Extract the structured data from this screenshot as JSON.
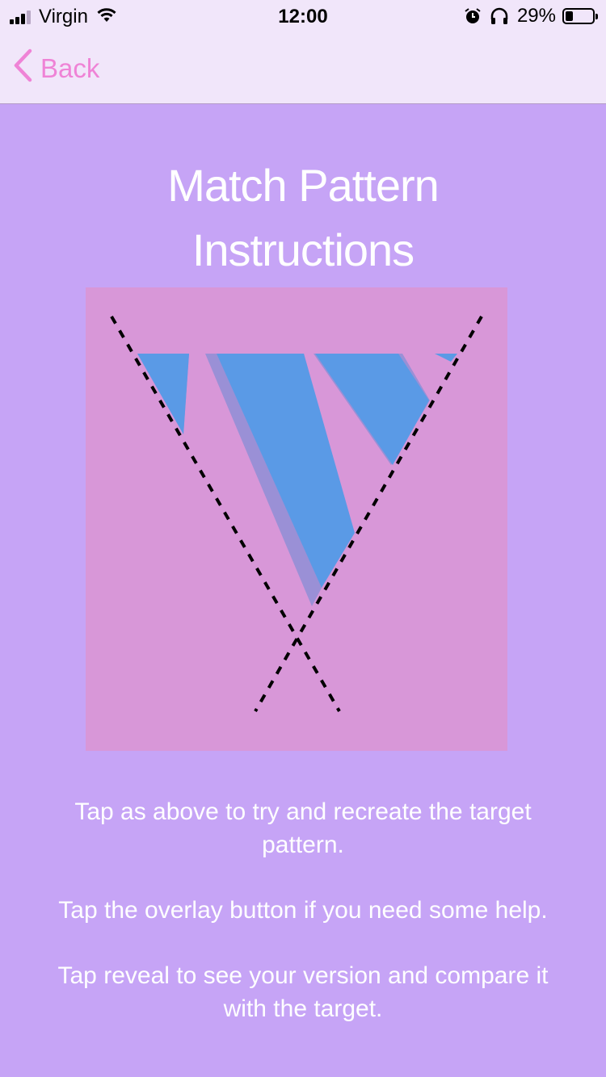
{
  "status_bar": {
    "carrier": "Virgin",
    "time": "12:00",
    "battery_percent": "29%",
    "battery_level": 0.29,
    "signal_bars": 3,
    "icons": [
      "wifi-icon",
      "alarm-icon",
      "headphones-icon",
      "battery-icon"
    ]
  },
  "nav": {
    "back_label": "Back",
    "accent_color": "#ef83d6"
  },
  "title": {
    "line1": "Match Pattern",
    "line2": "Instructions"
  },
  "pattern_illustration": {
    "background_color": "#d897d8",
    "fill_color": "#5a9ae6",
    "shadow_color": "#9a90d6",
    "guide_style": "dashed crossing lines"
  },
  "instructions": [
    "Tap as above to try and recreate the target pattern.",
    "Tap the overlay button if you need some help.",
    "Tap reveal to see your version and compare it with the target."
  ],
  "colors": {
    "page_background": "#c6a4f6",
    "bar_background": "#f1e6fa",
    "text_light": "#ffffff"
  }
}
